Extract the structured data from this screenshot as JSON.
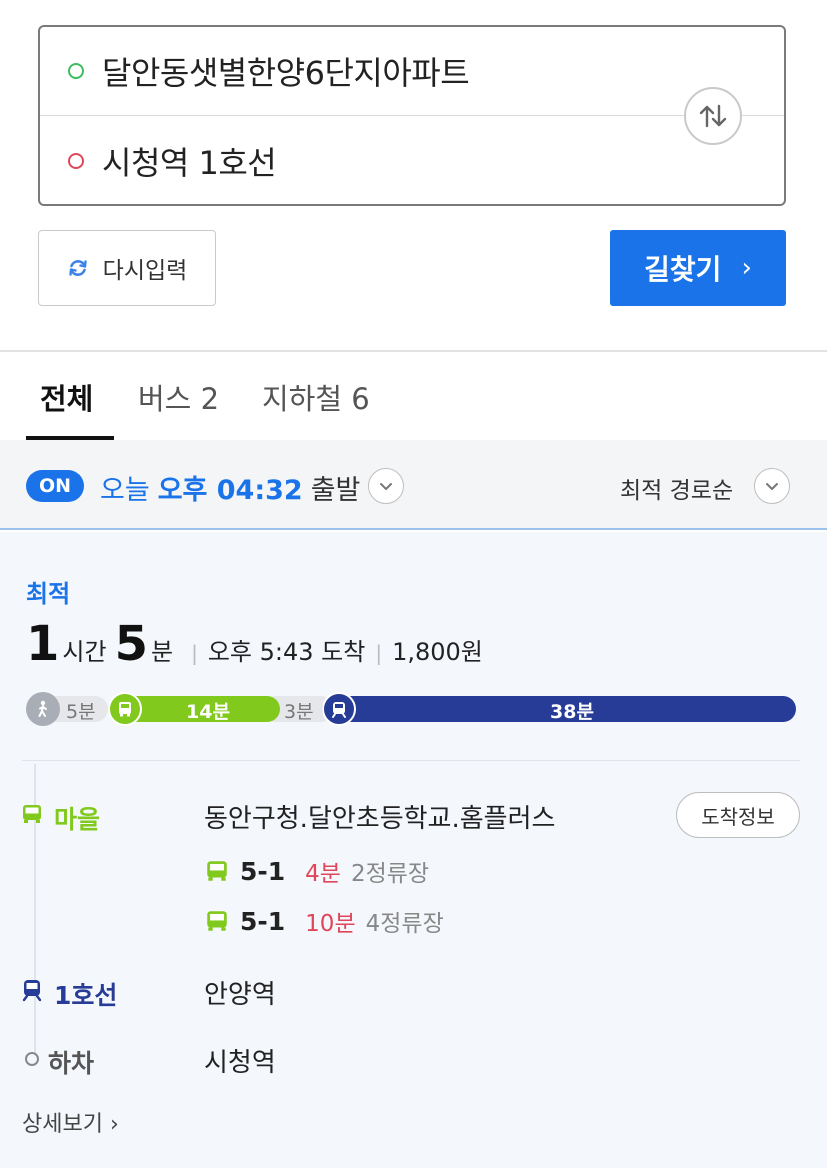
{
  "search": {
    "origin": "달안동샛별한양6단지아파트",
    "destination": "시청역 1호선"
  },
  "actions": {
    "reset_label": "다시입력",
    "find_label": "길찾기"
  },
  "tabs": [
    {
      "label": "전체",
      "active": true
    },
    {
      "label": "버스 2",
      "active": false
    },
    {
      "label": "지하철 6",
      "active": false
    }
  ],
  "time_filter": {
    "badge": "ON",
    "prefix": "오늘",
    "time": "오후 04:32",
    "suffix": "출발",
    "sort": "최적 경로순"
  },
  "result": {
    "tag": "최적",
    "hours": "1",
    "hours_unit": "시간",
    "minutes": "5",
    "minutes_unit": "분",
    "arrival": "오후 5:43 도착",
    "fare": "1,800원",
    "segments": [
      {
        "type": "walk",
        "label": "5분",
        "minutes": 5
      },
      {
        "type": "bus",
        "label": "14분",
        "minutes": 14
      },
      {
        "type": "transfer",
        "label": "3분",
        "minutes": 3
      },
      {
        "type": "subway",
        "label": "38분",
        "minutes": 38
      }
    ],
    "legs": {
      "bus": {
        "label": "마을",
        "stop": "동안구청.달안초등학교.홈플러스",
        "arrival_button": "도착정보",
        "color": "#82c91e",
        "arrivals": [
          {
            "number": "5-1",
            "minutes": "4분",
            "stops": "2정류장"
          },
          {
            "number": "5-1",
            "minutes": "10분",
            "stops": "4정류장"
          }
        ]
      },
      "subway": {
        "label": "1호선",
        "stop": "안양역",
        "color": "#263c96"
      },
      "alight": {
        "label": "하차",
        "stop": "시청역"
      }
    },
    "detail_link": "상세보기"
  },
  "colors": {
    "accent": "#1a73e8",
    "bus": "#82c91e",
    "subway": "#263c96",
    "alert": "#e0465a"
  }
}
